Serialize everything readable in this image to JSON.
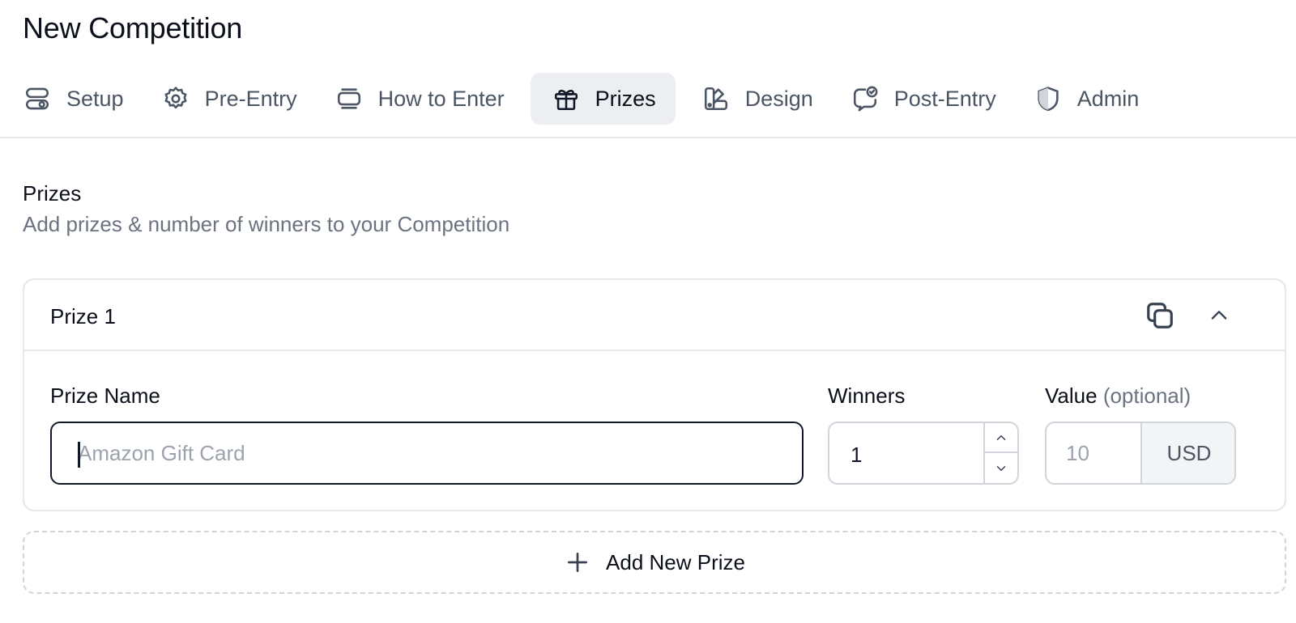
{
  "page": {
    "title": "New Competition"
  },
  "tabs": [
    {
      "label": "Setup",
      "icon": "setup-icon",
      "active": false
    },
    {
      "label": "Pre-Entry",
      "icon": "gear-icon",
      "active": false
    },
    {
      "label": "How to Enter",
      "icon": "stack-icon",
      "active": false
    },
    {
      "label": "Prizes",
      "icon": "gift-icon",
      "active": true
    },
    {
      "label": "Design",
      "icon": "palette-icon",
      "active": false
    },
    {
      "label": "Post-Entry",
      "icon": "message-check-icon",
      "active": false
    },
    {
      "label": "Admin",
      "icon": "shield-icon",
      "active": false
    }
  ],
  "section": {
    "title": "Prizes",
    "subtitle": "Add prizes & number of winners to your Competition"
  },
  "prize_card": {
    "title": "Prize 1",
    "prize_name_label": "Prize Name",
    "prize_name_value": "",
    "prize_name_placeholder": "Amazon Gift Card",
    "winners_label": "Winners",
    "winners_value": "1",
    "value_label": "Value",
    "value_optional": "(optional)",
    "value_value": "",
    "value_placeholder": "10",
    "currency": "USD"
  },
  "add_prize_label": "Add New Prize",
  "colors": {
    "active_tab_bg": "#eceef2",
    "text_muted": "#6b7280",
    "border": "#e5e7eb"
  }
}
